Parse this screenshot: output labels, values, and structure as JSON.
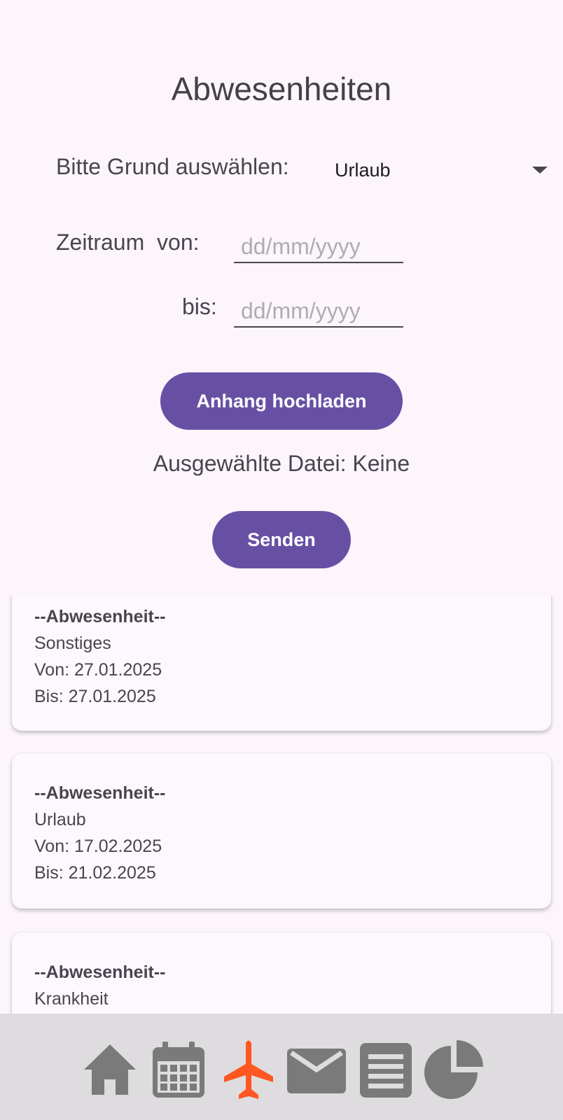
{
  "page": {
    "title": "Abwesenheiten"
  },
  "form": {
    "reason_label": "Bitte Grund auswählen:",
    "reason_value": "Urlaub",
    "period_from_label": "Zeitraum  von:",
    "period_to_label": "bis:",
    "date_placeholder": "dd/mm/yyyy",
    "upload_button": "Anhang hochladen",
    "selected_file": "Ausgewählte Datei: Keine",
    "send_button": "Senden"
  },
  "absences": [
    {
      "header": "--Abwesenheit--",
      "type": "Sonstiges",
      "from": "Von: 27.01.2025",
      "to": "Bis: 27.01.2025"
    },
    {
      "header": "--Abwesenheit--",
      "type": "Urlaub",
      "from": "Von: 17.02.2025",
      "to": "Bis: 21.02.2025"
    },
    {
      "header": "--Abwesenheit--",
      "type": "Krankheit"
    }
  ],
  "nav": {
    "items": [
      "home-icon",
      "calendar-icon",
      "airplane-icon",
      "mail-icon",
      "list-icon",
      "pie-chart-icon"
    ],
    "active": "airplane-icon",
    "active_color": "#ff5722",
    "icon_color": "#7a7a7a"
  },
  "colors": {
    "primary": "#6750a4",
    "background": "#fcf5fc"
  }
}
